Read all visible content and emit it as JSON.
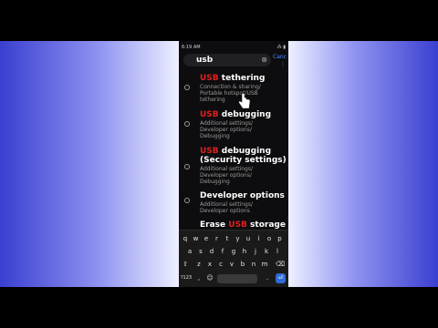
{
  "status_bar": {
    "time": "6:19 AM",
    "icons": "⁂ ▮"
  },
  "search": {
    "query": "usb",
    "clear_label": "⊗",
    "cancel_label": "Canc",
    "menu_label": "⋮"
  },
  "results": [
    {
      "hl": "USB",
      "rest": " tethering",
      "path": [
        "Connection & sharing/",
        "Portable hotspot/USB",
        "tethering"
      ]
    },
    {
      "hl": "USB",
      "rest": " debugging",
      "path": [
        "Additional settings/",
        "Developer options/",
        "Debugging"
      ]
    },
    {
      "hl": "USB",
      "rest": " debugging",
      "line2": "(Security settings)",
      "path": [
        "Additional settings/",
        "Developer options/",
        "Debugging"
      ]
    },
    {
      "pre": "Developer options",
      "path": [
        "Additional settings/",
        "Developer options"
      ]
    },
    {
      "pre": "Erase ",
      "hl": "USB",
      "rest": " storage",
      "path": []
    }
  ],
  "keyboard": {
    "row1": [
      "q",
      "w",
      "e",
      "r",
      "t",
      "y",
      "u",
      "i",
      "o",
      "p"
    ],
    "row2": [
      "a",
      "s",
      "d",
      "f",
      "g",
      "h",
      "j",
      "k",
      "l"
    ],
    "row3": [
      "z",
      "x",
      "c",
      "v",
      "b",
      "n",
      "m"
    ],
    "shift": "⇧",
    "backspace": "⌫",
    "mode_key": "?123",
    "emoji_key": "☺",
    "comma": ",",
    "period": ".",
    "enter": "⏎"
  }
}
